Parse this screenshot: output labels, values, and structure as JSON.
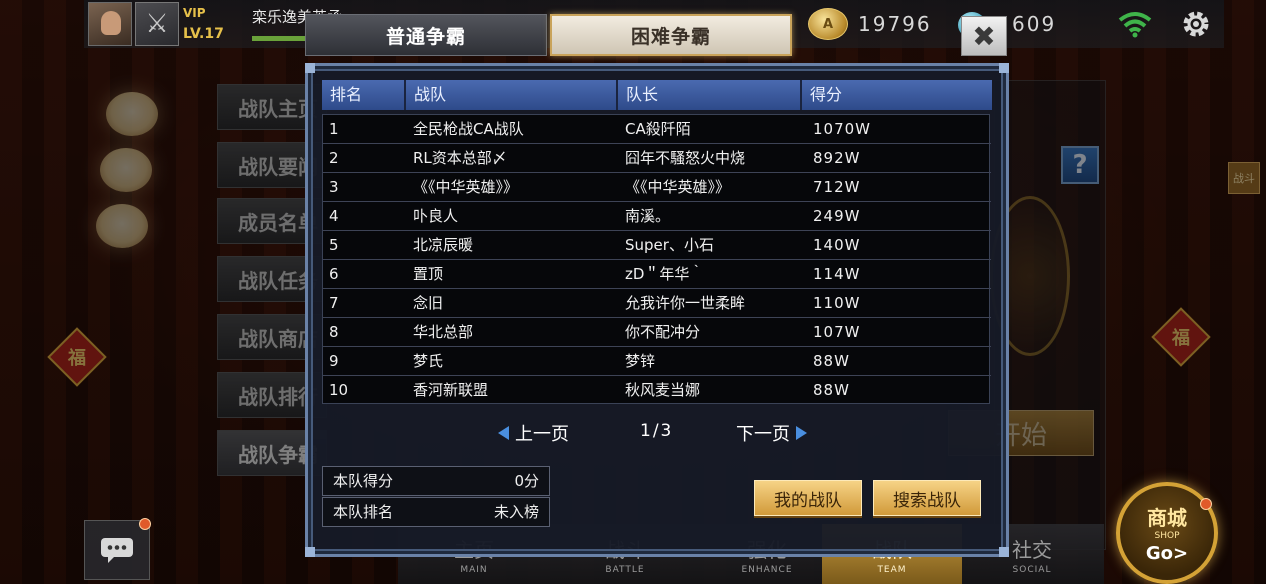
{
  "topbar": {
    "vip_label": "VIP",
    "level": "LV.17",
    "player_name": "栾乐逸美英承",
    "coins": "19796",
    "gems": "609"
  },
  "side_menu": {
    "items": [
      {
        "label": "战队主页"
      },
      {
        "label": "战队要闻"
      },
      {
        "label": "成员名单"
      },
      {
        "label": "战队任务"
      },
      {
        "label": "战队商店"
      },
      {
        "label": "战队排行"
      },
      {
        "label": "战队争霸"
      }
    ]
  },
  "background": {
    "start_label": "开始",
    "battle_tag": "战斗",
    "help_label": "?"
  },
  "popup": {
    "tabs": [
      {
        "label": "普通争霸",
        "selected": false
      },
      {
        "label": "困难争霸",
        "selected": true
      }
    ],
    "close_label": "✖",
    "columns": [
      "排名",
      "战队",
      "队长",
      "得分"
    ],
    "rows": [
      {
        "rank": "1",
        "team": "全民枪战CA战队",
        "captain": "CA殺阡陌",
        "score": "1070W"
      },
      {
        "rank": "2",
        "team": "RL资本总部〆",
        "captain": "囧年不騷怒火中烧",
        "score": "892W"
      },
      {
        "rank": "3",
        "team": "《《中华英雄》》",
        "captain": "《《中华英雄》》",
        "score": "712W"
      },
      {
        "rank": "4",
        "team": "卟良人",
        "captain": "南溪。",
        "score": "249W"
      },
      {
        "rank": "5",
        "team": "北凉辰暖",
        "captain": "Super、小石",
        "score": "140W"
      },
      {
        "rank": "6",
        "team": "置顶",
        "captain": "zD＂年华｀",
        "score": "114W"
      },
      {
        "rank": "7",
        "team": "念旧",
        "captain": "允我许你一世柔眸",
        "score": "110W"
      },
      {
        "rank": "8",
        "team": "华北总部",
        "captain": "你不配冲分",
        "score": "107W"
      },
      {
        "rank": "9",
        "team": "梦氏",
        "captain": "梦锌",
        "score": "88W"
      },
      {
        "rank": "10",
        "team": "香河新联盟",
        "captain": "秋风麦当娜",
        "score": "88W"
      }
    ],
    "pager": {
      "prev_label": "上一页",
      "next_label": "下一页",
      "page_indicator": "1/3"
    },
    "team_score_label": "本队得分",
    "team_score_value": "0分",
    "team_rank_label": "本队排名",
    "team_rank_value": "未入榜",
    "my_team_label": "我的战队",
    "search_team_label": "搜索战队"
  },
  "bottom_nav": {
    "items": [
      {
        "cn": "主页",
        "en": "MAIN"
      },
      {
        "cn": "战斗",
        "en": "BATTLE"
      },
      {
        "cn": "强化",
        "en": "ENHANCE"
      },
      {
        "cn": "战队",
        "en": "TEAM"
      },
      {
        "cn": "社交",
        "en": "SOCIAL"
      }
    ],
    "shop_cn": "商城",
    "shop_en": "SHOP",
    "shop_go": "Go>"
  },
  "colors": {
    "gold_button": "#d19a3a",
    "table_header": "#2e4a8a",
    "dialog_border": "#6a82a8"
  }
}
